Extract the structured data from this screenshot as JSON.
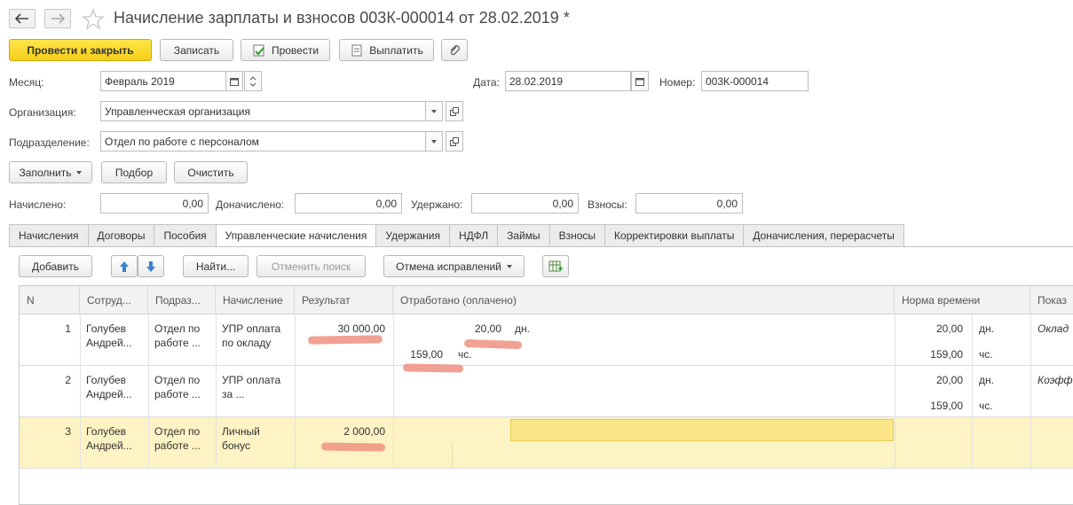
{
  "title": "Начисление зарплаты и взносов 003К-000014 от 28.02.2019 *",
  "toolbar": {
    "post_close": "Провести и закрыть",
    "save": "Записать",
    "post": "Провести",
    "pay": "Выплатить"
  },
  "month": {
    "label": "Месяц:",
    "value": "Февраль 2019"
  },
  "date": {
    "label": "Дата:",
    "value": "28.02.2019"
  },
  "number": {
    "label": "Номер:",
    "value": "003К-000014"
  },
  "org": {
    "label": "Организация:",
    "value": "Управленческая организация"
  },
  "dept": {
    "label": "Подразделение:",
    "value": "Отдел по работе с персоналом"
  },
  "actions": {
    "fill": "Заполнить",
    "select": "Подбор",
    "clear": "Очистить"
  },
  "totals": {
    "accrued_label": "Начислено:",
    "accrued": "0,00",
    "extra_label": "Доначислено:",
    "extra": "0,00",
    "withheld_label": "Удержано:",
    "withheld": "0,00",
    "contrib_label": "Взносы:",
    "contrib": "0,00"
  },
  "tabs": [
    "Начисления",
    "Договоры",
    "Пособия",
    "Управленческие начисления",
    "Удержания",
    "НДФЛ",
    "Займы",
    "Взносы",
    "Корректировки выплаты",
    "Доначисления, перерасчеты"
  ],
  "tabbar": {
    "add": "Добавить",
    "find": "Найти...",
    "cancel_search": "Отменить поиск",
    "cancel_corrections": "Отмена исправлений"
  },
  "columns": [
    "N",
    "Сотруд...",
    "Подраз...",
    "Начисление",
    "Результат",
    "Отработано (оплачено)",
    "Норма времени",
    "Показ"
  ],
  "rows": [
    {
      "n": "1",
      "emp1": "Голубев",
      "emp2": "Андрей...",
      "dep1": "Отдел по",
      "dep2": "работе ...",
      "acc1": "УПР оплата",
      "acc2": "по окладу",
      "result": "30 000,00",
      "worked_days": "20,00",
      "days_unit": "дн.",
      "worked_hours": "159,00",
      "hours_unit": "чс.",
      "norm_days": "20,00",
      "norm_days_unit": "дн.",
      "norm_hours": "159,00",
      "norm_hours_unit": "чс.",
      "indicator": "Оклад"
    },
    {
      "n": "2",
      "emp1": "Голубев",
      "emp2": "Андрей...",
      "dep1": "Отдел по",
      "dep2": "работе ...",
      "acc1": "УПР оплата",
      "acc2": "за ...",
      "norm_days": "20,00",
      "norm_days_unit": "дн.",
      "norm_hours": "159,00",
      "norm_hours_unit": "чс.",
      "indicator": "Коэфф"
    },
    {
      "n": "3",
      "emp1": "Голубев",
      "emp2": "Андрей...",
      "dep1": "Отдел по",
      "dep2": "работе ...",
      "acc1": "Личный",
      "acc2": "бонус",
      "result": "2 000,00"
    }
  ]
}
